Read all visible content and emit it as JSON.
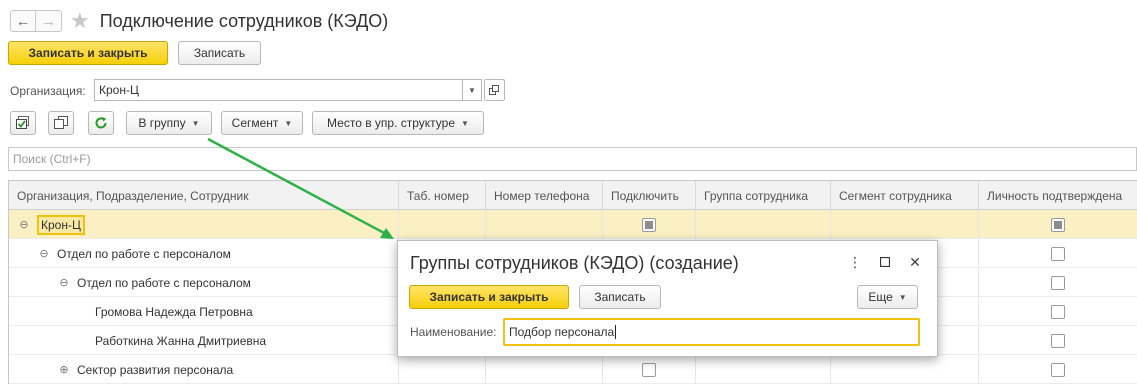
{
  "header": {
    "back_icon": "arrow-left-icon",
    "forward_icon": "arrow-right-icon",
    "favorite_icon": "star-icon",
    "title": "Подключение сотрудников (КЭДО)"
  },
  "toolbar": {
    "save_close": "Записать и закрыть",
    "save": "Записать"
  },
  "organization": {
    "label": "Организация:",
    "value": "Крон-Ц"
  },
  "list_toolbar": {
    "check_all_icon": "check-all-icon",
    "copy_icon": "copy-icon",
    "refresh_icon": "refresh-icon",
    "to_group": "В группу",
    "segment": "Сегмент",
    "structure_place": "Место в упр. структуре"
  },
  "search": {
    "placeholder": "Поиск (Ctrl+F)"
  },
  "table": {
    "columns": [
      "Организация, Подразделение, Сотрудник",
      "Таб. номер",
      "Номер телефона",
      "Подключить",
      "Группа сотрудника",
      "Сегмент сотрудника",
      "Личность подтверждена"
    ],
    "rows": [
      {
        "name": "Крон-Ц",
        "toggle": "⊖",
        "connect": "mixed",
        "identity": "mixed"
      },
      {
        "name": "Отдел по работе с персоналом",
        "toggle": "⊖",
        "connect": "",
        "identity": "empty"
      },
      {
        "name": "Отдел по работе с персоналом",
        "toggle": "⊖",
        "connect": "",
        "identity": "empty"
      },
      {
        "name": "Громова Надежда Петровна",
        "toggle": "",
        "connect": "",
        "identity": "empty"
      },
      {
        "name": "Работкина Жанна Дмитриевна",
        "toggle": "",
        "connect": "",
        "identity": "empty"
      },
      {
        "name": "Сектор развития персонала",
        "toggle": "⊕",
        "connect": "empty",
        "identity": "empty"
      }
    ]
  },
  "dialog": {
    "title": "Группы сотрудников (КЭДО) (создание)",
    "more_icon": "more-vertical-icon",
    "maximize_icon": "maximize-icon",
    "close_icon": "close-icon",
    "save_close": "Записать и закрыть",
    "save": "Записать",
    "more": "Еще",
    "name_label": "Наименование:",
    "name_value": "Подбор персонала"
  },
  "colors": {
    "accent_yellow": "#f7cf09",
    "selection_bg": "#fbefc4",
    "arrow_green": "#2db24a"
  }
}
